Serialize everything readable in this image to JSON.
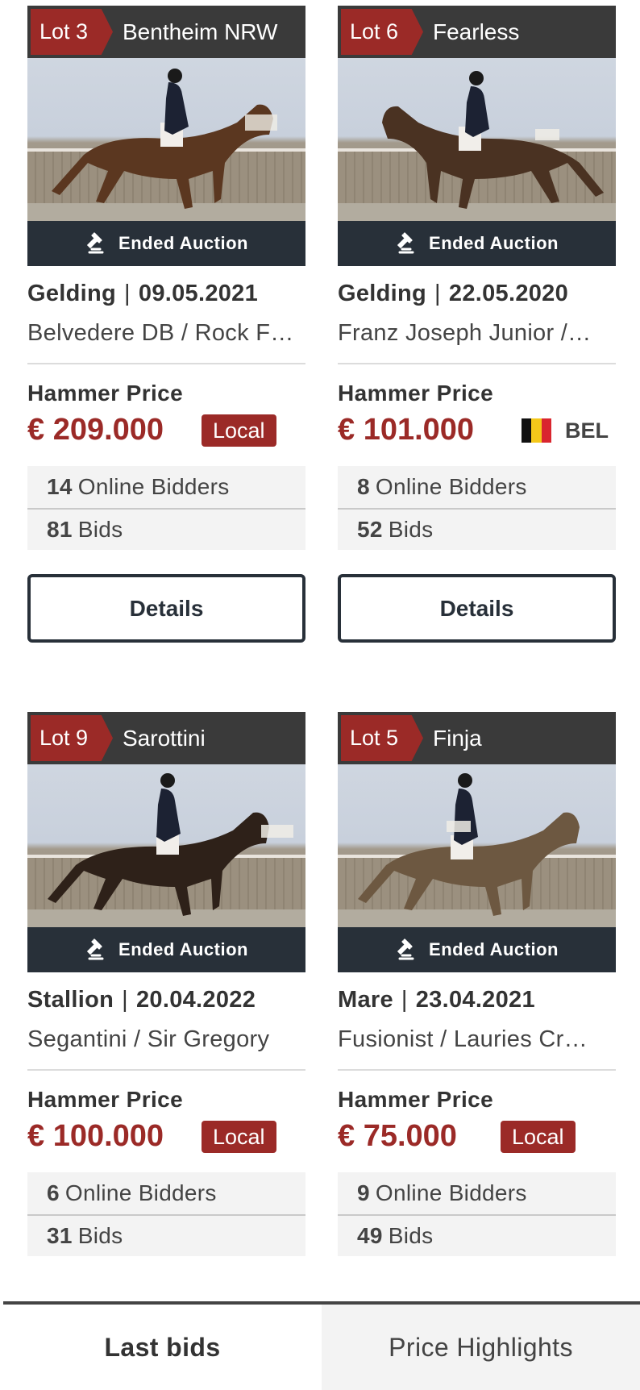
{
  "ended_label": "Ended Auction",
  "hammer_label": "Hammer Price",
  "details_label": "Details",
  "online_bidders_suffix": "Online Bidders",
  "bids_suffix": "Bids",
  "colors": {
    "accent_red": "#9b2a27",
    "dark_navy": "#283039",
    "lot_bar": "#3a3a3a"
  },
  "lots": [
    {
      "lot": "Lot 3",
      "name": "Bentheim NRW",
      "sex": "Gelding",
      "separator": "|",
      "date": "09.05.2021",
      "lineage": "Belvedere DB / Rock F…",
      "price": "€ 209.000",
      "badge": "Local",
      "online_bidders": "14",
      "bids": "81"
    },
    {
      "lot": "Lot 6",
      "name": "Fearless",
      "sex": "Gelding",
      "separator": "|",
      "date": "22.05.2020",
      "lineage": "Franz Joseph Junior /…",
      "price": "€ 101.000",
      "country": "BEL",
      "online_bidders": "8",
      "bids": "52"
    },
    {
      "lot": "Lot 9",
      "name": "Sarottini",
      "sex": "Stallion",
      "separator": "|",
      "date": "20.04.2022",
      "lineage": "Segantini / Sir Gregory",
      "price": "€ 100.000",
      "badge": "Local",
      "online_bidders": "6",
      "bids": "31"
    },
    {
      "lot": "Lot 5",
      "name": "Finja",
      "sex": "Mare",
      "separator": "|",
      "date": "23.04.2021",
      "lineage": "Fusionist / Lauries Cr…",
      "price": "€ 75.000",
      "badge": "Local",
      "online_bidders": "9",
      "bids": "49"
    }
  ],
  "tabs": [
    {
      "label": "Last bids",
      "active": true
    },
    {
      "label": "Price Highlights",
      "active": false
    }
  ]
}
